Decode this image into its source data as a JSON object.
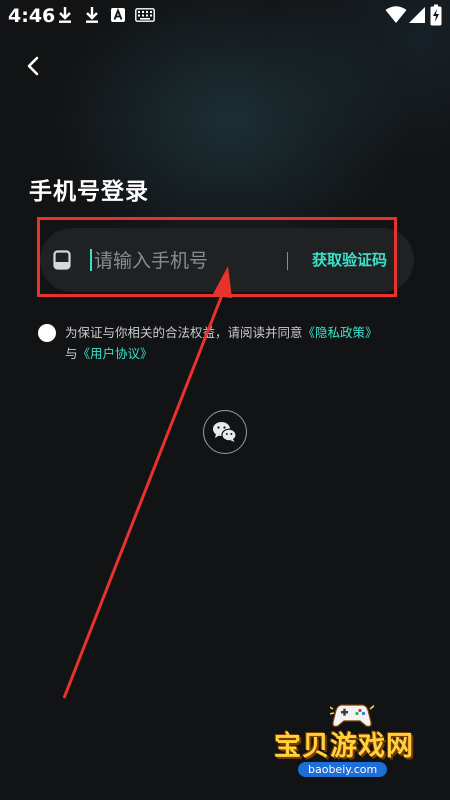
{
  "status_bar": {
    "time": "4:46",
    "icons": [
      "download-icon",
      "download-icon",
      "a-app-icon",
      "keyboard-icon",
      "wifi-icon",
      "signal-icon",
      "battery-charging-icon"
    ]
  },
  "header": {
    "back_icon": "chevron-left-icon",
    "title": "手机号登录"
  },
  "phone_form": {
    "phone_icon": "phone-icon",
    "placeholder": "请输入手机号",
    "value": "",
    "get_code_label": "获取验证码"
  },
  "agreement": {
    "text_prefix": "为保证与你相关的合法权益，请阅读并同意",
    "privacy_link": "《隐私政策》",
    "conjunction": "与",
    "user_link": "《用户协议》",
    "checked": false
  },
  "alt_login": {
    "wechat_icon": "wechat-icon"
  },
  "watermark": {
    "title": "宝贝游戏网",
    "url": "baobeiy.com"
  },
  "colors": {
    "accent": "#3de0c8",
    "background": "#121315",
    "input_bg": "#1f2123",
    "annotation": "#e8322c",
    "watermark_yellow": "#ffd23a"
  }
}
